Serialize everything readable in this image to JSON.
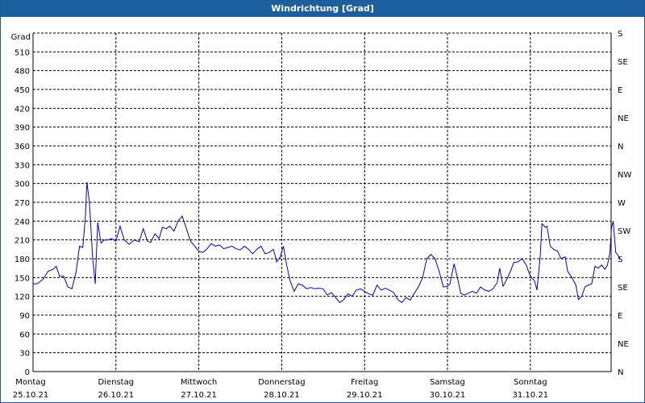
{
  "title": "Windrichtung [Grad]",
  "chart_data": {
    "type": "line",
    "title": "Windrichtung [Grad]",
    "ylabel": "Grad",
    "ylim": [
      0,
      540
    ],
    "yticks": [
      0,
      30,
      60,
      90,
      120,
      150,
      180,
      210,
      240,
      270,
      300,
      330,
      360,
      390,
      420,
      450,
      480,
      510
    ],
    "right_axis": {
      "ticks": [
        0,
        45,
        90,
        135,
        180,
        225,
        270,
        315,
        360,
        405,
        450,
        495,
        540
      ],
      "labels": [
        "N",
        "NE",
        "E",
        "SE",
        "S",
        "SW",
        "W",
        "NW",
        "N",
        "NE",
        "E",
        "SE",
        "S"
      ]
    },
    "xlim": [
      0,
      7
    ],
    "x_labels": [
      {
        "day": "Montag",
        "date": "25.10.21"
      },
      {
        "day": "Dienstag",
        "date": "26.10.21"
      },
      {
        "day": "Mittwoch",
        "date": "27.10.21"
      },
      {
        "day": "Donnerstag",
        "date": "28.10.21"
      },
      {
        "day": "Freitag",
        "date": "29.10.21"
      },
      {
        "day": "Samstag",
        "date": "30.10.21"
      },
      {
        "day": "Sonntag",
        "date": "31.10.21"
      }
    ],
    "grid": true,
    "series": [
      {
        "color": "#0000c0",
        "points": [
          [
            0.0,
            140
          ],
          [
            0.05,
            140
          ],
          [
            0.12,
            147
          ],
          [
            0.18,
            160
          ],
          [
            0.24,
            163
          ],
          [
            0.28,
            168
          ],
          [
            0.32,
            152
          ],
          [
            0.37,
            152
          ],
          [
            0.42,
            135
          ],
          [
            0.47,
            132
          ],
          [
            0.52,
            160
          ],
          [
            0.56,
            200
          ],
          [
            0.6,
            198
          ],
          [
            0.63,
            245
          ],
          [
            0.65,
            302
          ],
          [
            0.68,
            270
          ],
          [
            0.72,
            180
          ],
          [
            0.75,
            140
          ],
          [
            0.78,
            238
          ],
          [
            0.82,
            205
          ],
          [
            0.86,
            210
          ],
          [
            0.9,
            210
          ],
          [
            0.95,
            212
          ],
          [
            1.0,
            208
          ],
          [
            1.05,
            232
          ],
          [
            1.1,
            210
          ],
          [
            1.16,
            203
          ],
          [
            1.22,
            210
          ],
          [
            1.28,
            207
          ],
          [
            1.33,
            228
          ],
          [
            1.38,
            208
          ],
          [
            1.42,
            206
          ],
          [
            1.47,
            220
          ],
          [
            1.52,
            212
          ],
          [
            1.56,
            230
          ],
          [
            1.61,
            228
          ],
          [
            1.65,
            232
          ],
          [
            1.7,
            224
          ],
          [
            1.75,
            240
          ],
          [
            1.8,
            248
          ],
          [
            1.85,
            228
          ],
          [
            1.9,
            208
          ],
          [
            1.95,
            200
          ],
          [
            2.0,
            192
          ],
          [
            2.05,
            190
          ],
          [
            2.1,
            196
          ],
          [
            2.15,
            204
          ],
          [
            2.2,
            200
          ],
          [
            2.25,
            202
          ],
          [
            2.3,
            196
          ],
          [
            2.35,
            198
          ],
          [
            2.4,
            200
          ],
          [
            2.45,
            196
          ],
          [
            2.5,
            194
          ],
          [
            2.55,
            200
          ],
          [
            2.6,
            195
          ],
          [
            2.65,
            188
          ],
          [
            2.7,
            195
          ],
          [
            2.75,
            200
          ],
          [
            2.8,
            188
          ],
          [
            2.85,
            190
          ],
          [
            2.9,
            195
          ],
          [
            2.94,
            175
          ],
          [
            2.98,
            182
          ],
          [
            3.02,
            200
          ],
          [
            3.06,
            170
          ],
          [
            3.1,
            145
          ],
          [
            3.15,
            128
          ],
          [
            3.2,
            140
          ],
          [
            3.25,
            138
          ],
          [
            3.3,
            132
          ],
          [
            3.35,
            134
          ],
          [
            3.4,
            132
          ],
          [
            3.45,
            133
          ],
          [
            3.5,
            132
          ],
          [
            3.55,
            122
          ],
          [
            3.6,
            126
          ],
          [
            3.65,
            118
          ],
          [
            3.7,
            110
          ],
          [
            3.75,
            115
          ],
          [
            3.8,
            124
          ],
          [
            3.85,
            120
          ],
          [
            3.9,
            130
          ],
          [
            3.95,
            132
          ],
          [
            4.0,
            128
          ],
          [
            4.05,
            124
          ],
          [
            4.1,
            122
          ],
          [
            4.15,
            138
          ],
          [
            4.2,
            130
          ],
          [
            4.25,
            133
          ],
          [
            4.3,
            130
          ],
          [
            4.35,
            126
          ],
          [
            4.4,
            115
          ],
          [
            4.45,
            110
          ],
          [
            4.5,
            118
          ],
          [
            4.55,
            114
          ],
          [
            4.6,
            125
          ],
          [
            4.65,
            135
          ],
          [
            4.7,
            150
          ],
          [
            4.75,
            180
          ],
          [
            4.8,
            187
          ],
          [
            4.85,
            180
          ],
          [
            4.9,
            160
          ],
          [
            4.95,
            135
          ],
          [
            5.0,
            136
          ],
          [
            5.03,
            140
          ],
          [
            5.08,
            172
          ],
          [
            5.12,
            150
          ],
          [
            5.16,
            125
          ],
          [
            5.2,
            122
          ],
          [
            5.25,
            125
          ],
          [
            5.3,
            128
          ],
          [
            5.35,
            125
          ],
          [
            5.4,
            135
          ],
          [
            5.45,
            130
          ],
          [
            5.5,
            128
          ],
          [
            5.55,
            132
          ],
          [
            5.6,
            142
          ],
          [
            5.63,
            165
          ],
          [
            5.67,
            136
          ],
          [
            5.72,
            148
          ],
          [
            5.76,
            160
          ],
          [
            5.8,
            174
          ],
          [
            5.85,
            175
          ],
          [
            5.9,
            180
          ],
          [
            5.95,
            170
          ],
          [
            6.0,
            152
          ],
          [
            6.05,
            145
          ],
          [
            6.08,
            130
          ],
          [
            6.12,
            185
          ],
          [
            6.14,
            236
          ],
          [
            6.18,
            230
          ],
          [
            6.2,
            232
          ],
          [
            6.24,
            200
          ],
          [
            6.28,
            195
          ],
          [
            6.33,
            192
          ],
          [
            6.37,
            180
          ],
          [
            6.42,
            183
          ],
          [
            6.45,
            160
          ],
          [
            6.5,
            150
          ],
          [
            6.55,
            138
          ],
          [
            6.58,
            115
          ],
          [
            6.62,
            120
          ],
          [
            6.66,
            135
          ],
          [
            6.7,
            138
          ],
          [
            6.74,
            140
          ],
          [
            6.78,
            168
          ],
          [
            6.82,
            165
          ],
          [
            6.86,
            170
          ],
          [
            6.9,
            163
          ],
          [
            6.93,
            170
          ],
          [
            6.96,
            190
          ],
          [
            6.98,
            230
          ],
          [
            7.0,
            240
          ],
          [
            7.03,
            190
          ],
          [
            7.06,
            185
          ],
          [
            7.08,
            180
          ]
        ]
      }
    ]
  }
}
